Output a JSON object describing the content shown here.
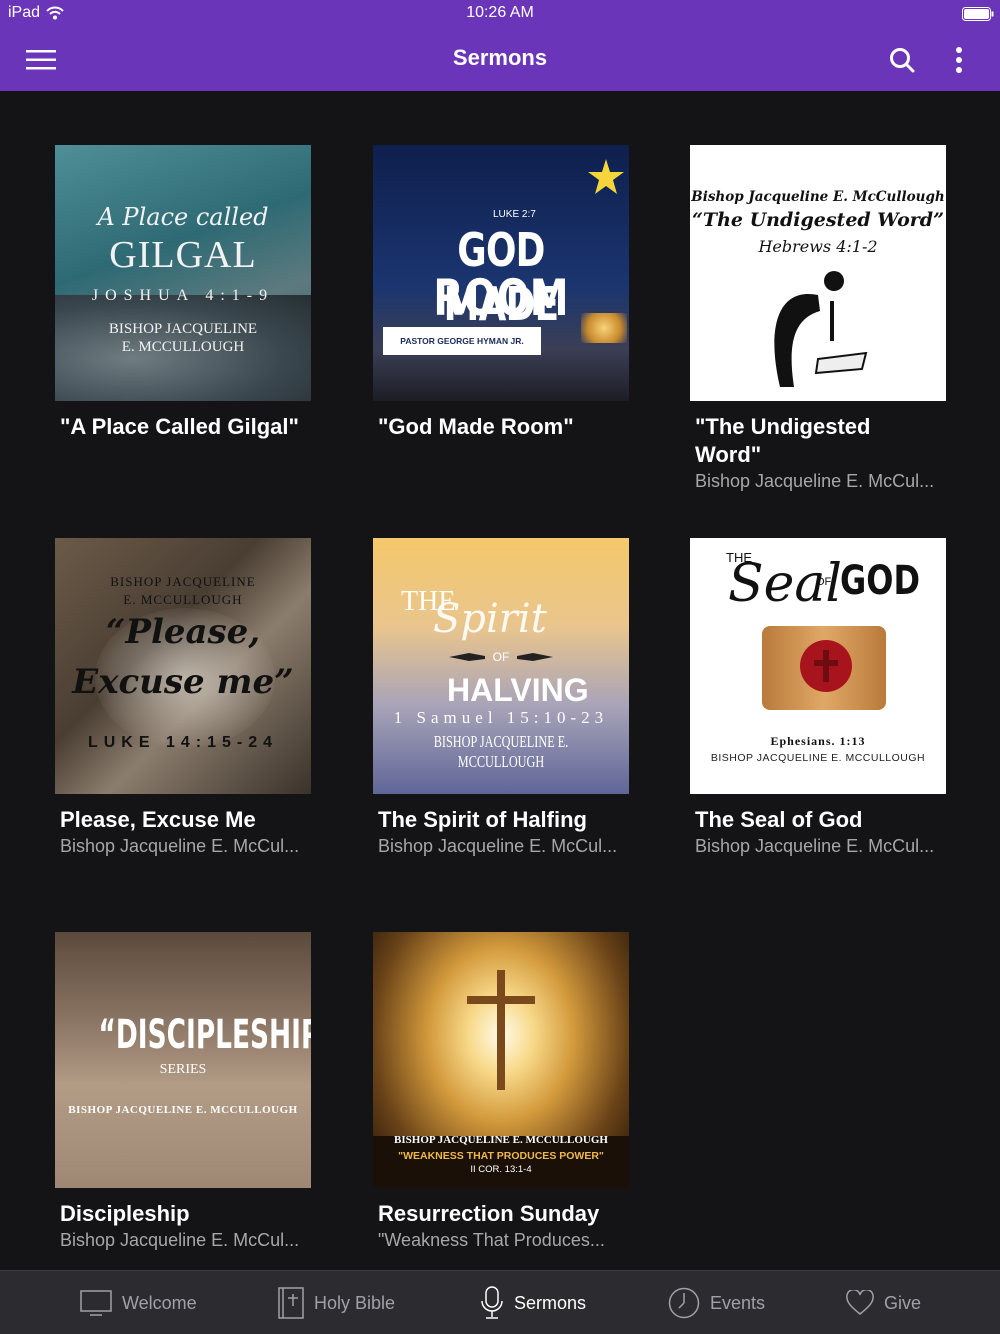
{
  "status": {
    "device": "iPad",
    "time": "10:26 AM"
  },
  "header": {
    "title": "Sermons"
  },
  "sermons": [
    {
      "title": "\"A Place Called Gilgal\"",
      "subtitle": "",
      "art": {
        "line1": "A Place called",
        "line2": "GILGAL",
        "line3": "JOSHUA 4:1-9",
        "line4": "BISHOP JACQUELINE",
        "line5": "E. MCCULLOUGH"
      }
    },
    {
      "title": "\"God Made Room\"",
      "subtitle": "",
      "art": {
        "line1": "LUKE 2:7",
        "line2": "GOD MADE",
        "line3": "ROOM",
        "line4": "PASTOR GEORGE HYMAN JR."
      }
    },
    {
      "title": "\"The Undigested Word\"",
      "subtitle": "Bishop Jacqueline E. McCul...",
      "art": {
        "line1": "Bishop Jacqueline E. McCullough",
        "line2": "“The Undigested Word”",
        "line3": "Hebrews 4:1-2"
      }
    },
    {
      "title": "Please, Excuse Me",
      "subtitle": "Bishop Jacqueline E. McCul...",
      "art": {
        "line1": "BISHOP JACQUELINE",
        "line2": "E. MCCULLOUGH",
        "line3": "“Please,",
        "line4": "Excuse me”",
        "line5": "LUKE 14:15-24"
      }
    },
    {
      "title": "The Spirit of Halfing",
      "subtitle": "Bishop Jacqueline E. McCul...",
      "art": {
        "line1": "THE",
        "line2": "Spirit",
        "line3": "OF",
        "line4": "HALVING",
        "line5": "1 Samuel 15:10-23",
        "line6": "BISHOP JACQUELINE E. MCCULLOUGH"
      }
    },
    {
      "title": "The Seal of God",
      "subtitle": "Bishop Jacqueline E. McCul...",
      "art": {
        "line1": "THE",
        "line2": "Seal",
        "line3": "OF",
        "line4": "GOD",
        "line5": "Ephesians. 1:13",
        "line6": "BISHOP JACQUELINE E. MCCULLOUGH"
      }
    },
    {
      "title": "Discipleship",
      "subtitle": "Bishop Jacqueline E. McCul...",
      "art": {
        "line1": "“DISCIPLESHIP”",
        "line2": "SERIES",
        "line3": "BISHOP JACQUELINE E. MCCULLOUGH"
      }
    },
    {
      "title": "Resurrection Sunday",
      "subtitle": "\"Weakness That Produces...",
      "art": {
        "line1": "BISHOP JACQUELINE E. MCCULLOUGH",
        "line2": "\"WEAKNESS THAT PRODUCES POWER\"",
        "line3": "II COR. 13:1-4"
      }
    }
  ],
  "tabs": [
    {
      "label": "Welcome",
      "icon": "monitor-icon",
      "active": false
    },
    {
      "label": "Holy Bible",
      "icon": "bible-icon",
      "active": false
    },
    {
      "label": "Sermons",
      "icon": "microphone-icon",
      "active": true
    },
    {
      "label": "Events",
      "icon": "clock-icon",
      "active": false
    },
    {
      "label": "Give",
      "icon": "heart-icon",
      "active": false
    }
  ],
  "colors": {
    "accent": "#6a35b8",
    "background": "#141417",
    "tabbar": "#2c2c30"
  }
}
